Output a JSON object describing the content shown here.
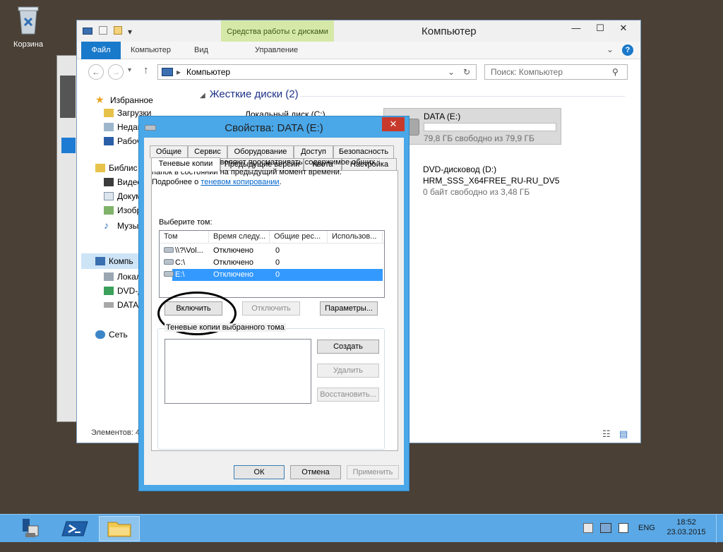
{
  "desktop": {
    "recycle_bin_label": "Корзина"
  },
  "explorer": {
    "title": "Компьютер",
    "context_tab": "Средства работы с дисками",
    "qat_symbol": "▾",
    "ribbon_tabs": [
      "Файл",
      "Компьютер",
      "Вид",
      "Управление"
    ],
    "win_buttons": [
      "—",
      "☐",
      "✕"
    ],
    "ribbon_right": [
      "⌄",
      "?"
    ],
    "nav_back": "←",
    "nav_forward": "→",
    "nav_recent": "▾",
    "nav_up": "↑",
    "address": "Компьютер",
    "address_sep": "▸",
    "address_dropdown": "⌄",
    "address_refresh": "↻",
    "search_placeholder": "Поиск: Компьютер",
    "search_icon": "⚲",
    "nav_pane": {
      "favorites": "Избранное",
      "downloads": "Загрузки",
      "recent": "Недав",
      "desktop": "Рабоч",
      "libraries": "Библис",
      "videos": "Видео",
      "documents": "Докум",
      "images": "Изобр",
      "music": "Музы",
      "computer": "Компь",
      "local": "Локал",
      "dvd": "DVD-д",
      "data": "DATA",
      "network": "Сеть"
    },
    "group_header": "Жесткие диски (2)",
    "group_toggle": "◢",
    "drives": [
      {
        "name": "Локальный диск (C:)"
      },
      {
        "name": "DATA (E:)",
        "free": "79,8 ГБ свободно из 79,9 ГБ",
        "used_fraction": 0.0
      },
      {
        "name": "DVD-дисковод (D:)",
        "label": "HRM_SSS_X64FREE_RU-RU_DV5",
        "free": "0 байт свободно из 3,48 ГБ"
      }
    ],
    "status": "Элементов: 4",
    "view_icons": [
      "☷",
      "▤"
    ]
  },
  "dialog": {
    "title": "Свойства: DATA (E:)",
    "close": "✕",
    "tabs_row1": [
      "Общие",
      "Сервис",
      "Оборудование",
      "Доступ",
      "Безопасность"
    ],
    "tabs_row2": [
      "Теневые копии",
      "Предыдущие версии",
      "Квота",
      "Настройка"
    ],
    "description": "Теневые копии позволяют просматривать содержимое общих папок в состоянии на предыдущий момент времени.",
    "more_prefix": "Подробнее о",
    "more_link": "теневом копировании",
    "more_suffix": ".",
    "select_volume": "Выберите том:",
    "columns": [
      "Том",
      "Время следу...",
      "Общие рес...",
      "Использов..."
    ],
    "volumes": [
      {
        "vol": "\\\\?\\Vol...",
        "next": "Отключено",
        "shares": "0"
      },
      {
        "vol": "C:\\",
        "next": "Отключено",
        "shares": "0"
      },
      {
        "vol": "E:\\",
        "next": "Отключено",
        "shares": "0"
      }
    ],
    "btn_enable": "Включить",
    "btn_disable": "Отключить",
    "btn_settings": "Параметры...",
    "group_label": "Теневые копии выбранного тома",
    "btn_create": "Создать",
    "btn_delete": "Удалить",
    "btn_restore": "Восстановить...",
    "btn_ok": "ОК",
    "btn_cancel": "Отмена",
    "btn_apply": "Применить"
  },
  "taskbar": {
    "lang": "ENG",
    "time": "18:52",
    "date": "23.03.2015"
  },
  "colors": {
    "accent": "#1979ca",
    "dialog_frame": "#4aa7e8",
    "taskbar": "#5aa8e6",
    "selection": "#3399ff",
    "context_tab": "#d6e8a8"
  }
}
